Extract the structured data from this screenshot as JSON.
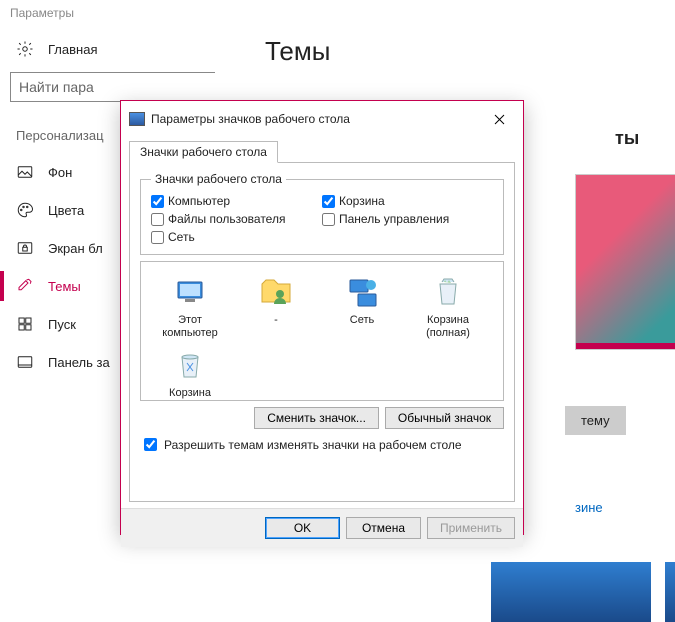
{
  "app_title": "Параметры",
  "sidebar": {
    "home": "Главная",
    "search_placeholder": "Найти пара",
    "section": "Персонализац",
    "items": [
      {
        "label": "Фон",
        "icon": "image-icon"
      },
      {
        "label": "Цвета",
        "icon": "palette-icon"
      },
      {
        "label": "Экран бл",
        "icon": "lockscreen-icon"
      },
      {
        "label": "Темы",
        "icon": "themes-icon",
        "active": true
      },
      {
        "label": "Пуск",
        "icon": "start-icon"
      },
      {
        "label": "Панель за",
        "icon": "taskbar-icon"
      }
    ]
  },
  "page": {
    "title": "Темы",
    "theme_label_partial": "ты",
    "button_partial": "тему",
    "store_link_partial": "зине"
  },
  "dialog": {
    "title": "Параметры значков рабочего стола",
    "tab": "Значки рабочего стола",
    "group_legend": "Значки рабочего стола",
    "checkboxes": [
      {
        "label": "Компьютер",
        "checked": true
      },
      {
        "label": "Корзина",
        "checked": true
      },
      {
        "label": "Файлы пользователя",
        "checked": false
      },
      {
        "label": "Панель управления",
        "checked": false
      },
      {
        "label": "Сеть",
        "checked": false
      }
    ],
    "icons": [
      {
        "label": "Этот компьютер",
        "glyph": "pc"
      },
      {
        "label": "-",
        "glyph": "user"
      },
      {
        "label": "Сеть",
        "glyph": "network"
      },
      {
        "label": "Корзина (полная)",
        "glyph": "bin-full"
      },
      {
        "label": "Корзина (пустая)",
        "glyph": "bin-empty"
      }
    ],
    "change_icon": "Сменить значок...",
    "default_icon": "Обычный значок",
    "allow_themes": "Разрешить темам изменять значки на рабочем столе",
    "allow_themes_checked": true,
    "ok": "OK",
    "cancel": "Отмена",
    "apply": "Применить"
  }
}
